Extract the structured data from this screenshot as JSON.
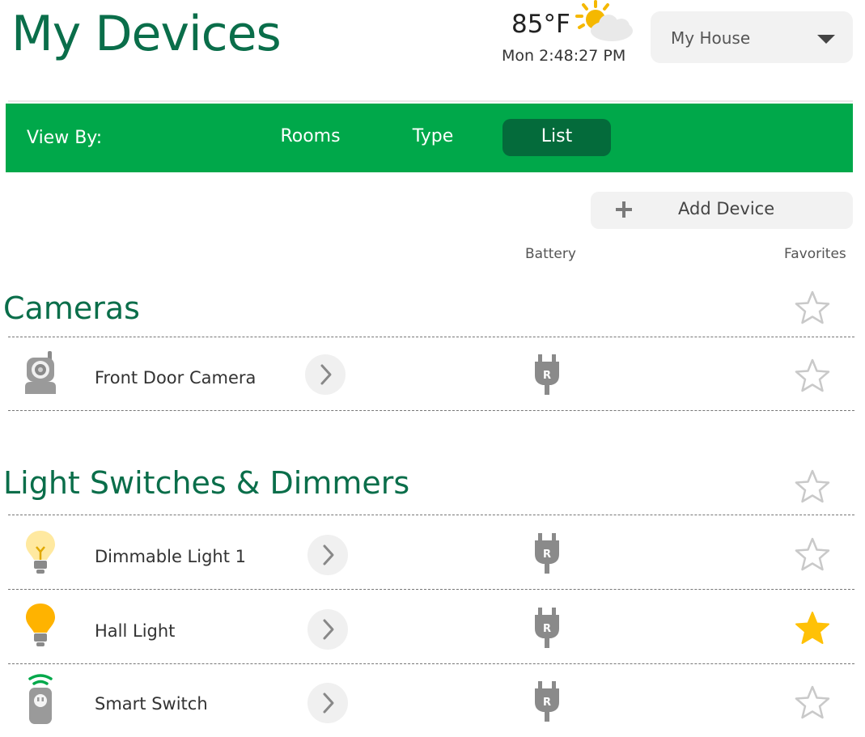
{
  "header": {
    "title": "My Devices",
    "temperature": "85°F",
    "weather_icon": "partly-sunny-icon",
    "clock": "Mon 2:48:27 PM",
    "location_select": "My House"
  },
  "view_by": {
    "label": "View By:",
    "tabs": [
      {
        "label": "Rooms",
        "selected": false
      },
      {
        "label": "Type",
        "selected": false
      },
      {
        "label": "List",
        "selected": true
      }
    ]
  },
  "actions": {
    "add_device": "Add Device"
  },
  "columns": {
    "battery": "Battery",
    "favorites": "Favorites"
  },
  "colors": {
    "brand_green": "#00a84a",
    "title_green": "#0a6e4a",
    "selected_tab": "#046b3b",
    "favorite_star": "#ffc107"
  },
  "sections": [
    {
      "title": "Cameras",
      "favorite": false,
      "devices": [
        {
          "name": "Front Door Camera",
          "icon": "camera-icon",
          "power": "plug-icon",
          "power_letter": "R",
          "favorite": false
        }
      ]
    },
    {
      "title": "Light Switches & Dimmers",
      "favorite": false,
      "devices": [
        {
          "name": "Dimmable Light 1",
          "icon": "dim-bulb-icon",
          "power": "plug-icon",
          "power_letter": "R",
          "favorite": false
        },
        {
          "name": "Hall Light",
          "icon": "bulb-icon",
          "power": "plug-icon",
          "power_letter": "R",
          "favorite": true
        },
        {
          "name": "Smart Switch",
          "icon": "smart-switch-icon",
          "power": "plug-icon",
          "power_letter": "R",
          "favorite": false
        }
      ]
    }
  ]
}
